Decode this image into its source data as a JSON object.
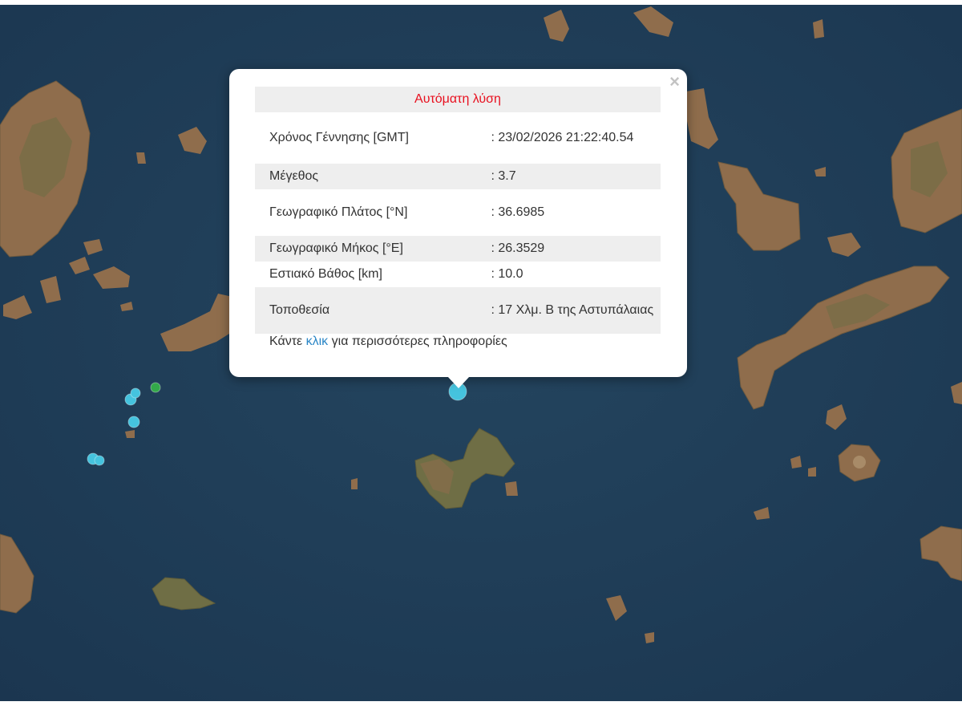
{
  "map": {
    "colors": {
      "sea": "#1f3c57",
      "land": "#8f6d4c",
      "vegetation": "#6f6e45",
      "quake_cyan": "#45c3de",
      "quake_green": "#33a84a"
    },
    "quake_markers": [
      {
        "color": "cyan"
      },
      {
        "color": "cyan"
      },
      {
        "color": "cyan"
      },
      {
        "color": "cyan"
      },
      {
        "color": "cyan"
      },
      {
        "color": "green"
      },
      {
        "color": "cyan",
        "selected": true
      }
    ]
  },
  "popup": {
    "close_symbol": "×",
    "header": "Αυτόματη λύση",
    "rows": [
      {
        "label": "Χρόνος Γέννησης [GMT]",
        "value": ": 23/02/2026 21:22:40.54"
      },
      {
        "label": "Μέγεθος",
        "value": ": 3.7"
      },
      {
        "label": "Γεωγραφικό Πλάτος [°N]",
        "value": ": 36.6985"
      },
      {
        "label": "Γεωγραφικό Μήκος [°E]",
        "value": ": 26.3529"
      },
      {
        "label": "Εστιακό Βάθος [km]",
        "value": ": 10.0"
      },
      {
        "label": "Τοποθεσία",
        "value": ": 17 Χλμ. Β της Αστυπάλαιας"
      }
    ],
    "link_prefix": "Κάντε ",
    "link_text": "κλικ",
    "link_suffix": " για περισσότερες πληροφορίες"
  }
}
